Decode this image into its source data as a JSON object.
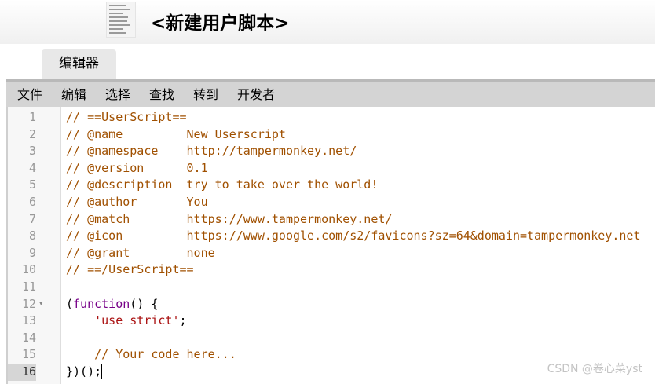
{
  "header": {
    "title": "<新建用户脚本>",
    "logo_icon": "script-thumbnail-icon"
  },
  "tabs": [
    {
      "label": "编辑器",
      "active": true
    }
  ],
  "menu": {
    "items": [
      "文件",
      "编辑",
      "选择",
      "查找",
      "转到",
      "开发者"
    ]
  },
  "editor": {
    "line_numbers": [
      "1",
      "2",
      "3",
      "4",
      "5",
      "6",
      "7",
      "8",
      "9",
      "10",
      "11",
      "12",
      "13",
      "14",
      "15",
      "16"
    ],
    "active_line": "16",
    "fold_marker_line": "12",
    "lines": [
      [
        {
          "t": "comment",
          "v": "// ==UserScript=="
        }
      ],
      [
        {
          "t": "comment",
          "v": "// @name         New Userscript"
        }
      ],
      [
        {
          "t": "comment",
          "v": "// @namespace    http://tampermonkey.net/"
        }
      ],
      [
        {
          "t": "comment",
          "v": "// @version      0.1"
        }
      ],
      [
        {
          "t": "comment",
          "v": "// @description  try to take over the world!"
        }
      ],
      [
        {
          "t": "comment",
          "v": "// @author       You"
        }
      ],
      [
        {
          "t": "comment",
          "v": "// @match        https://www.tampermonkey.net/"
        }
      ],
      [
        {
          "t": "comment",
          "v": "// @icon         https://www.google.com/s2/favicons?sz=64&domain=tampermonkey.net"
        }
      ],
      [
        {
          "t": "comment",
          "v": "// @grant        none"
        }
      ],
      [
        {
          "t": "comment",
          "v": "// ==/UserScript=="
        }
      ],
      [
        {
          "t": "plain",
          "v": ""
        }
      ],
      [
        {
          "t": "plain",
          "v": "("
        },
        {
          "t": "kw",
          "v": "function"
        },
        {
          "t": "plain",
          "v": "() {"
        }
      ],
      [
        {
          "t": "plain",
          "v": "    "
        },
        {
          "t": "str",
          "v": "'use strict'"
        },
        {
          "t": "plain",
          "v": ";"
        }
      ],
      [
        {
          "t": "plain",
          "v": ""
        }
      ],
      [
        {
          "t": "plain",
          "v": "    "
        },
        {
          "t": "comment",
          "v": "// Your code here..."
        }
      ],
      [
        {
          "t": "plain",
          "v": "})();"
        }
      ]
    ]
  },
  "watermark": "CSDN @卷心菜yst"
}
